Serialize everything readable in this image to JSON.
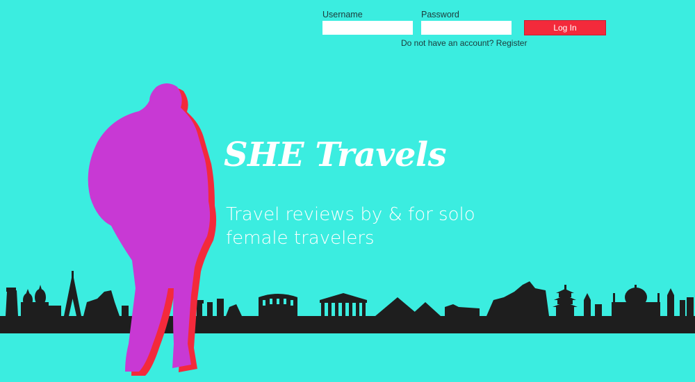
{
  "login": {
    "username_label": "Username",
    "username_value": "",
    "password_label": "Password",
    "password_value": "",
    "login_button": "Log In",
    "register_prompt": "Do not have an account?",
    "register_link": "Register"
  },
  "hero": {
    "title": "SHE Travels",
    "tagline": "Travel reviews by & for solo female travelers"
  },
  "colors": {
    "background": "#3BEDE0",
    "accent_red": "#F32A3B",
    "silhouette_magenta": "#C839D4",
    "skyline": "#1E1E1E"
  },
  "icons": {
    "traveler": "backpacker-silhouette-illustration",
    "skyline": "world-landmarks-skyline-illustration"
  }
}
